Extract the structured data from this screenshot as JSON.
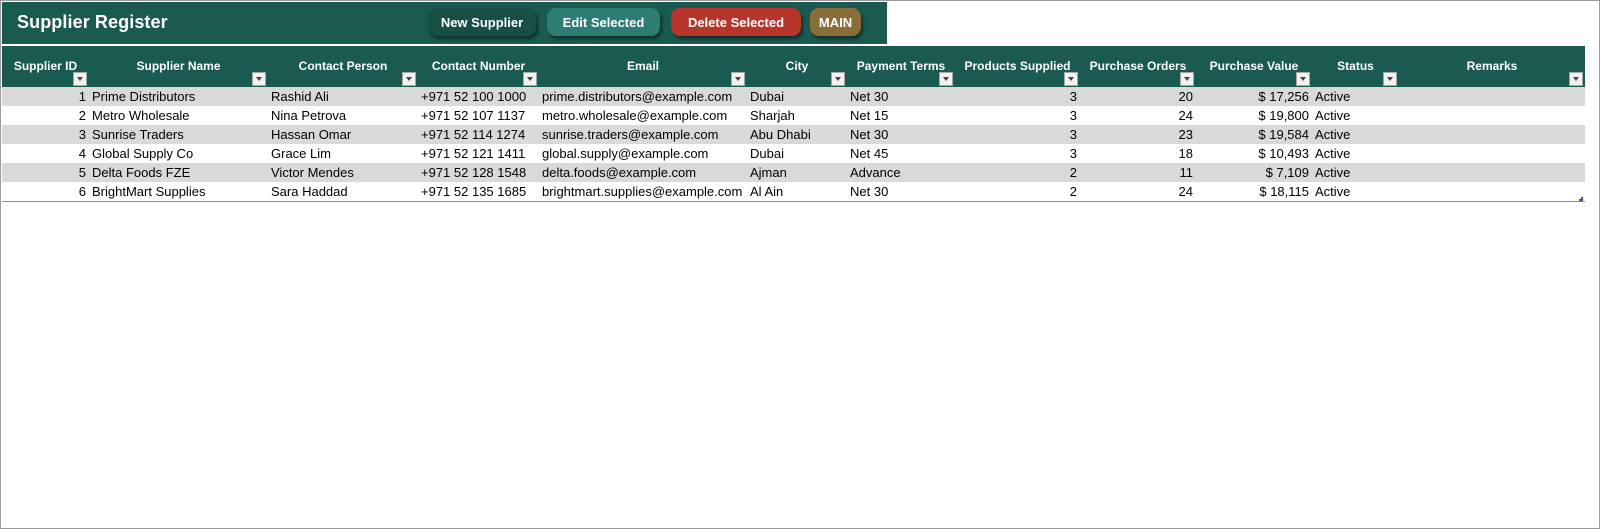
{
  "app": {
    "title": "Supplier Register"
  },
  "toolbar": {
    "new_label": "New Supplier",
    "edit_label": "Edit Selected",
    "delete_label": "Delete Selected",
    "main_label": "MAIN"
  },
  "colors": {
    "header_green": "#1b5a50",
    "new_button": "#174f46",
    "edit_button": "#2d7d73",
    "delete_button": "#b8352c",
    "main_button": "#8a6e3a",
    "band_row": "#d9d9d9"
  },
  "table": {
    "columns": [
      "Supplier ID",
      "Supplier Name",
      "Contact Person",
      "Contact Number",
      "Email",
      "City",
      "Payment Terms",
      "Products Supplied",
      "Purchase Orders",
      "Purchase Value",
      "Status",
      "Remarks"
    ],
    "rows": [
      [
        "1",
        "Prime Distributors",
        "Rashid Ali",
        "+971 52 100 1000",
        "prime.distributors@example.com",
        "Dubai",
        "Net 30",
        "3",
        "20",
        "$ 17,256",
        "Active",
        ""
      ],
      [
        "2",
        "Metro Wholesale",
        "Nina Petrova",
        "+971 52 107 1137",
        "metro.wholesale@example.com",
        "Sharjah",
        "Net 15",
        "3",
        "24",
        "$ 19,800",
        "Active",
        ""
      ],
      [
        "3",
        "Sunrise Traders",
        "Hassan Omar",
        "+971 52 114 1274",
        "sunrise.traders@example.com",
        "Abu Dhabi",
        "Net 30",
        "3",
        "23",
        "$ 19,584",
        "Active",
        ""
      ],
      [
        "4",
        "Global Supply Co",
        "Grace Lim",
        "+971 52 121 1411",
        "global.supply@example.com",
        "Dubai",
        "Net 45",
        "3",
        "18",
        "$ 10,493",
        "Active",
        ""
      ],
      [
        "5",
        "Delta Foods FZE",
        "Victor Mendes",
        "+971 52 128 1548",
        "delta.foods@example.com",
        "Ajman",
        "Advance",
        "2",
        "11",
        "$ 7,109",
        "Active",
        ""
      ],
      [
        "6",
        "BrightMart Supplies",
        "Sara Haddad",
        "+971 52 135 1685",
        "brightmart.supplies@example.com",
        "Al Ain",
        "Net 30",
        "2",
        "24",
        "$ 18,115",
        "Active",
        ""
      ]
    ]
  }
}
